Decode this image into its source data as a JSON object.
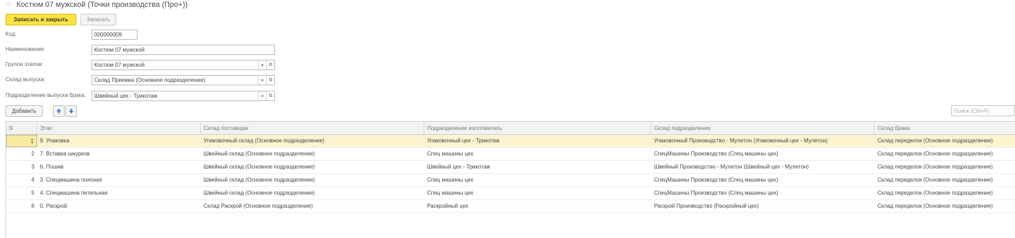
{
  "window": {
    "star_icon": "star-icon",
    "title": "Костюм 07 мужской (Точки производства (Про+))"
  },
  "toolbar": {
    "save_close_label": "Записать и закрыть",
    "save_label": "Записать"
  },
  "form": {
    "code_label": "Код:",
    "code_value": "000000009",
    "name_label": "Наименование:",
    "name_value": "Костюм 07 мужской",
    "group_label": "Группа этапов:",
    "group_value": "Костюм 07 мужской",
    "warehouse_label": "Склад выпуска:",
    "warehouse_value": "Склад Приемка (Основное подразделение)",
    "defect_label": "Подразделение выпуска брака:",
    "defect_value": "Швейный цех - Трикотаж"
  },
  "table_toolbar": {
    "add_label": "Добавить",
    "up_icon": "arrow-up-icon",
    "down_icon": "arrow-down-icon",
    "search_placeholder": "Поиск (Ctrl+F)"
  },
  "table": {
    "columns": [
      "N",
      "Этап",
      "Склад поставщик",
      "Подразделение изготовитель",
      "Склад подразделения",
      "Склад брака"
    ],
    "rows": [
      [
        "1",
        "9. Упаковка",
        "Упаковочный склад (Основное подразделение)",
        "Упаковочный цех - Трикотаж",
        "Упаковочный Производство - Мулетон (Упаковочный цех - Мулетон)",
        "Склад переделок (Основное подразделение)"
      ],
      [
        "2",
        "7. Вставка шнурков",
        "Швейный склад (Основное подразделение)",
        "Спец машины цех",
        "СпецМашины Производство (Спец машины цех)",
        "Склад переделок (Основное подразделение)"
      ],
      [
        "3",
        "6. Пошив",
        "Швейный склад (Основное подразделение)",
        "Швейный цех - Трикотаж",
        "Швейный Производство - Мулетон (Швейный цех - Мулетон)",
        "Склад переделок (Основное подразделение)"
      ],
      [
        "4",
        "3. Спецмашина поясная",
        "Швейный склад (Основное подразделение)",
        "Спец машины цех",
        "СпецМашины Производство (Спец машины цех)",
        "Склад переделок (Основное подразделение)"
      ],
      [
        "5",
        "4. Спецмашина петельная",
        "Швейный склад (Основное подразделение)",
        "Спец машины цех",
        "СпецМашины Производство (Спец машины цех)",
        "Склад переделок (Основное подразделение)"
      ],
      [
        "6",
        "0. Раскрой",
        "Склад Раскрой (Основное подразделение)",
        "Раскройный цех",
        "Раскрой Производство (Раскройный цех)",
        "Склад переделок (Основное подразделение)"
      ]
    ],
    "selected_row": 0
  }
}
